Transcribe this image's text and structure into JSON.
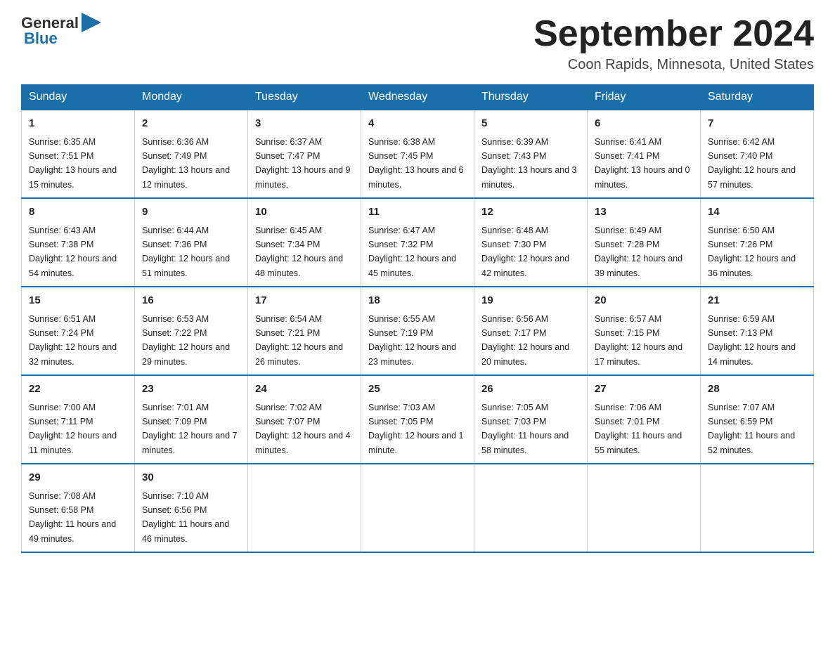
{
  "logo": {
    "general": "General",
    "blue": "Blue"
  },
  "title": "September 2024",
  "location": "Coon Rapids, Minnesota, United States",
  "headers": [
    "Sunday",
    "Monday",
    "Tuesday",
    "Wednesday",
    "Thursday",
    "Friday",
    "Saturday"
  ],
  "weeks": [
    [
      {
        "day": "1",
        "sunrise": "Sunrise: 6:35 AM",
        "sunset": "Sunset: 7:51 PM",
        "daylight": "Daylight: 13 hours and 15 minutes."
      },
      {
        "day": "2",
        "sunrise": "Sunrise: 6:36 AM",
        "sunset": "Sunset: 7:49 PM",
        "daylight": "Daylight: 13 hours and 12 minutes."
      },
      {
        "day": "3",
        "sunrise": "Sunrise: 6:37 AM",
        "sunset": "Sunset: 7:47 PM",
        "daylight": "Daylight: 13 hours and 9 minutes."
      },
      {
        "day": "4",
        "sunrise": "Sunrise: 6:38 AM",
        "sunset": "Sunset: 7:45 PM",
        "daylight": "Daylight: 13 hours and 6 minutes."
      },
      {
        "day": "5",
        "sunrise": "Sunrise: 6:39 AM",
        "sunset": "Sunset: 7:43 PM",
        "daylight": "Daylight: 13 hours and 3 minutes."
      },
      {
        "day": "6",
        "sunrise": "Sunrise: 6:41 AM",
        "sunset": "Sunset: 7:41 PM",
        "daylight": "Daylight: 13 hours and 0 minutes."
      },
      {
        "day": "7",
        "sunrise": "Sunrise: 6:42 AM",
        "sunset": "Sunset: 7:40 PM",
        "daylight": "Daylight: 12 hours and 57 minutes."
      }
    ],
    [
      {
        "day": "8",
        "sunrise": "Sunrise: 6:43 AM",
        "sunset": "Sunset: 7:38 PM",
        "daylight": "Daylight: 12 hours and 54 minutes."
      },
      {
        "day": "9",
        "sunrise": "Sunrise: 6:44 AM",
        "sunset": "Sunset: 7:36 PM",
        "daylight": "Daylight: 12 hours and 51 minutes."
      },
      {
        "day": "10",
        "sunrise": "Sunrise: 6:45 AM",
        "sunset": "Sunset: 7:34 PM",
        "daylight": "Daylight: 12 hours and 48 minutes."
      },
      {
        "day": "11",
        "sunrise": "Sunrise: 6:47 AM",
        "sunset": "Sunset: 7:32 PM",
        "daylight": "Daylight: 12 hours and 45 minutes."
      },
      {
        "day": "12",
        "sunrise": "Sunrise: 6:48 AM",
        "sunset": "Sunset: 7:30 PM",
        "daylight": "Daylight: 12 hours and 42 minutes."
      },
      {
        "day": "13",
        "sunrise": "Sunrise: 6:49 AM",
        "sunset": "Sunset: 7:28 PM",
        "daylight": "Daylight: 12 hours and 39 minutes."
      },
      {
        "day": "14",
        "sunrise": "Sunrise: 6:50 AM",
        "sunset": "Sunset: 7:26 PM",
        "daylight": "Daylight: 12 hours and 36 minutes."
      }
    ],
    [
      {
        "day": "15",
        "sunrise": "Sunrise: 6:51 AM",
        "sunset": "Sunset: 7:24 PM",
        "daylight": "Daylight: 12 hours and 32 minutes."
      },
      {
        "day": "16",
        "sunrise": "Sunrise: 6:53 AM",
        "sunset": "Sunset: 7:22 PM",
        "daylight": "Daylight: 12 hours and 29 minutes."
      },
      {
        "day": "17",
        "sunrise": "Sunrise: 6:54 AM",
        "sunset": "Sunset: 7:21 PM",
        "daylight": "Daylight: 12 hours and 26 minutes."
      },
      {
        "day": "18",
        "sunrise": "Sunrise: 6:55 AM",
        "sunset": "Sunset: 7:19 PM",
        "daylight": "Daylight: 12 hours and 23 minutes."
      },
      {
        "day": "19",
        "sunrise": "Sunrise: 6:56 AM",
        "sunset": "Sunset: 7:17 PM",
        "daylight": "Daylight: 12 hours and 20 minutes."
      },
      {
        "day": "20",
        "sunrise": "Sunrise: 6:57 AM",
        "sunset": "Sunset: 7:15 PM",
        "daylight": "Daylight: 12 hours and 17 minutes."
      },
      {
        "day": "21",
        "sunrise": "Sunrise: 6:59 AM",
        "sunset": "Sunset: 7:13 PM",
        "daylight": "Daylight: 12 hours and 14 minutes."
      }
    ],
    [
      {
        "day": "22",
        "sunrise": "Sunrise: 7:00 AM",
        "sunset": "Sunset: 7:11 PM",
        "daylight": "Daylight: 12 hours and 11 minutes."
      },
      {
        "day": "23",
        "sunrise": "Sunrise: 7:01 AM",
        "sunset": "Sunset: 7:09 PM",
        "daylight": "Daylight: 12 hours and 7 minutes."
      },
      {
        "day": "24",
        "sunrise": "Sunrise: 7:02 AM",
        "sunset": "Sunset: 7:07 PM",
        "daylight": "Daylight: 12 hours and 4 minutes."
      },
      {
        "day": "25",
        "sunrise": "Sunrise: 7:03 AM",
        "sunset": "Sunset: 7:05 PM",
        "daylight": "Daylight: 12 hours and 1 minute."
      },
      {
        "day": "26",
        "sunrise": "Sunrise: 7:05 AM",
        "sunset": "Sunset: 7:03 PM",
        "daylight": "Daylight: 11 hours and 58 minutes."
      },
      {
        "day": "27",
        "sunrise": "Sunrise: 7:06 AM",
        "sunset": "Sunset: 7:01 PM",
        "daylight": "Daylight: 11 hours and 55 minutes."
      },
      {
        "day": "28",
        "sunrise": "Sunrise: 7:07 AM",
        "sunset": "Sunset: 6:59 PM",
        "daylight": "Daylight: 11 hours and 52 minutes."
      }
    ],
    [
      {
        "day": "29",
        "sunrise": "Sunrise: 7:08 AM",
        "sunset": "Sunset: 6:58 PM",
        "daylight": "Daylight: 11 hours and 49 minutes."
      },
      {
        "day": "30",
        "sunrise": "Sunrise: 7:10 AM",
        "sunset": "Sunset: 6:56 PM",
        "daylight": "Daylight: 11 hours and 46 minutes."
      },
      null,
      null,
      null,
      null,
      null
    ]
  ]
}
